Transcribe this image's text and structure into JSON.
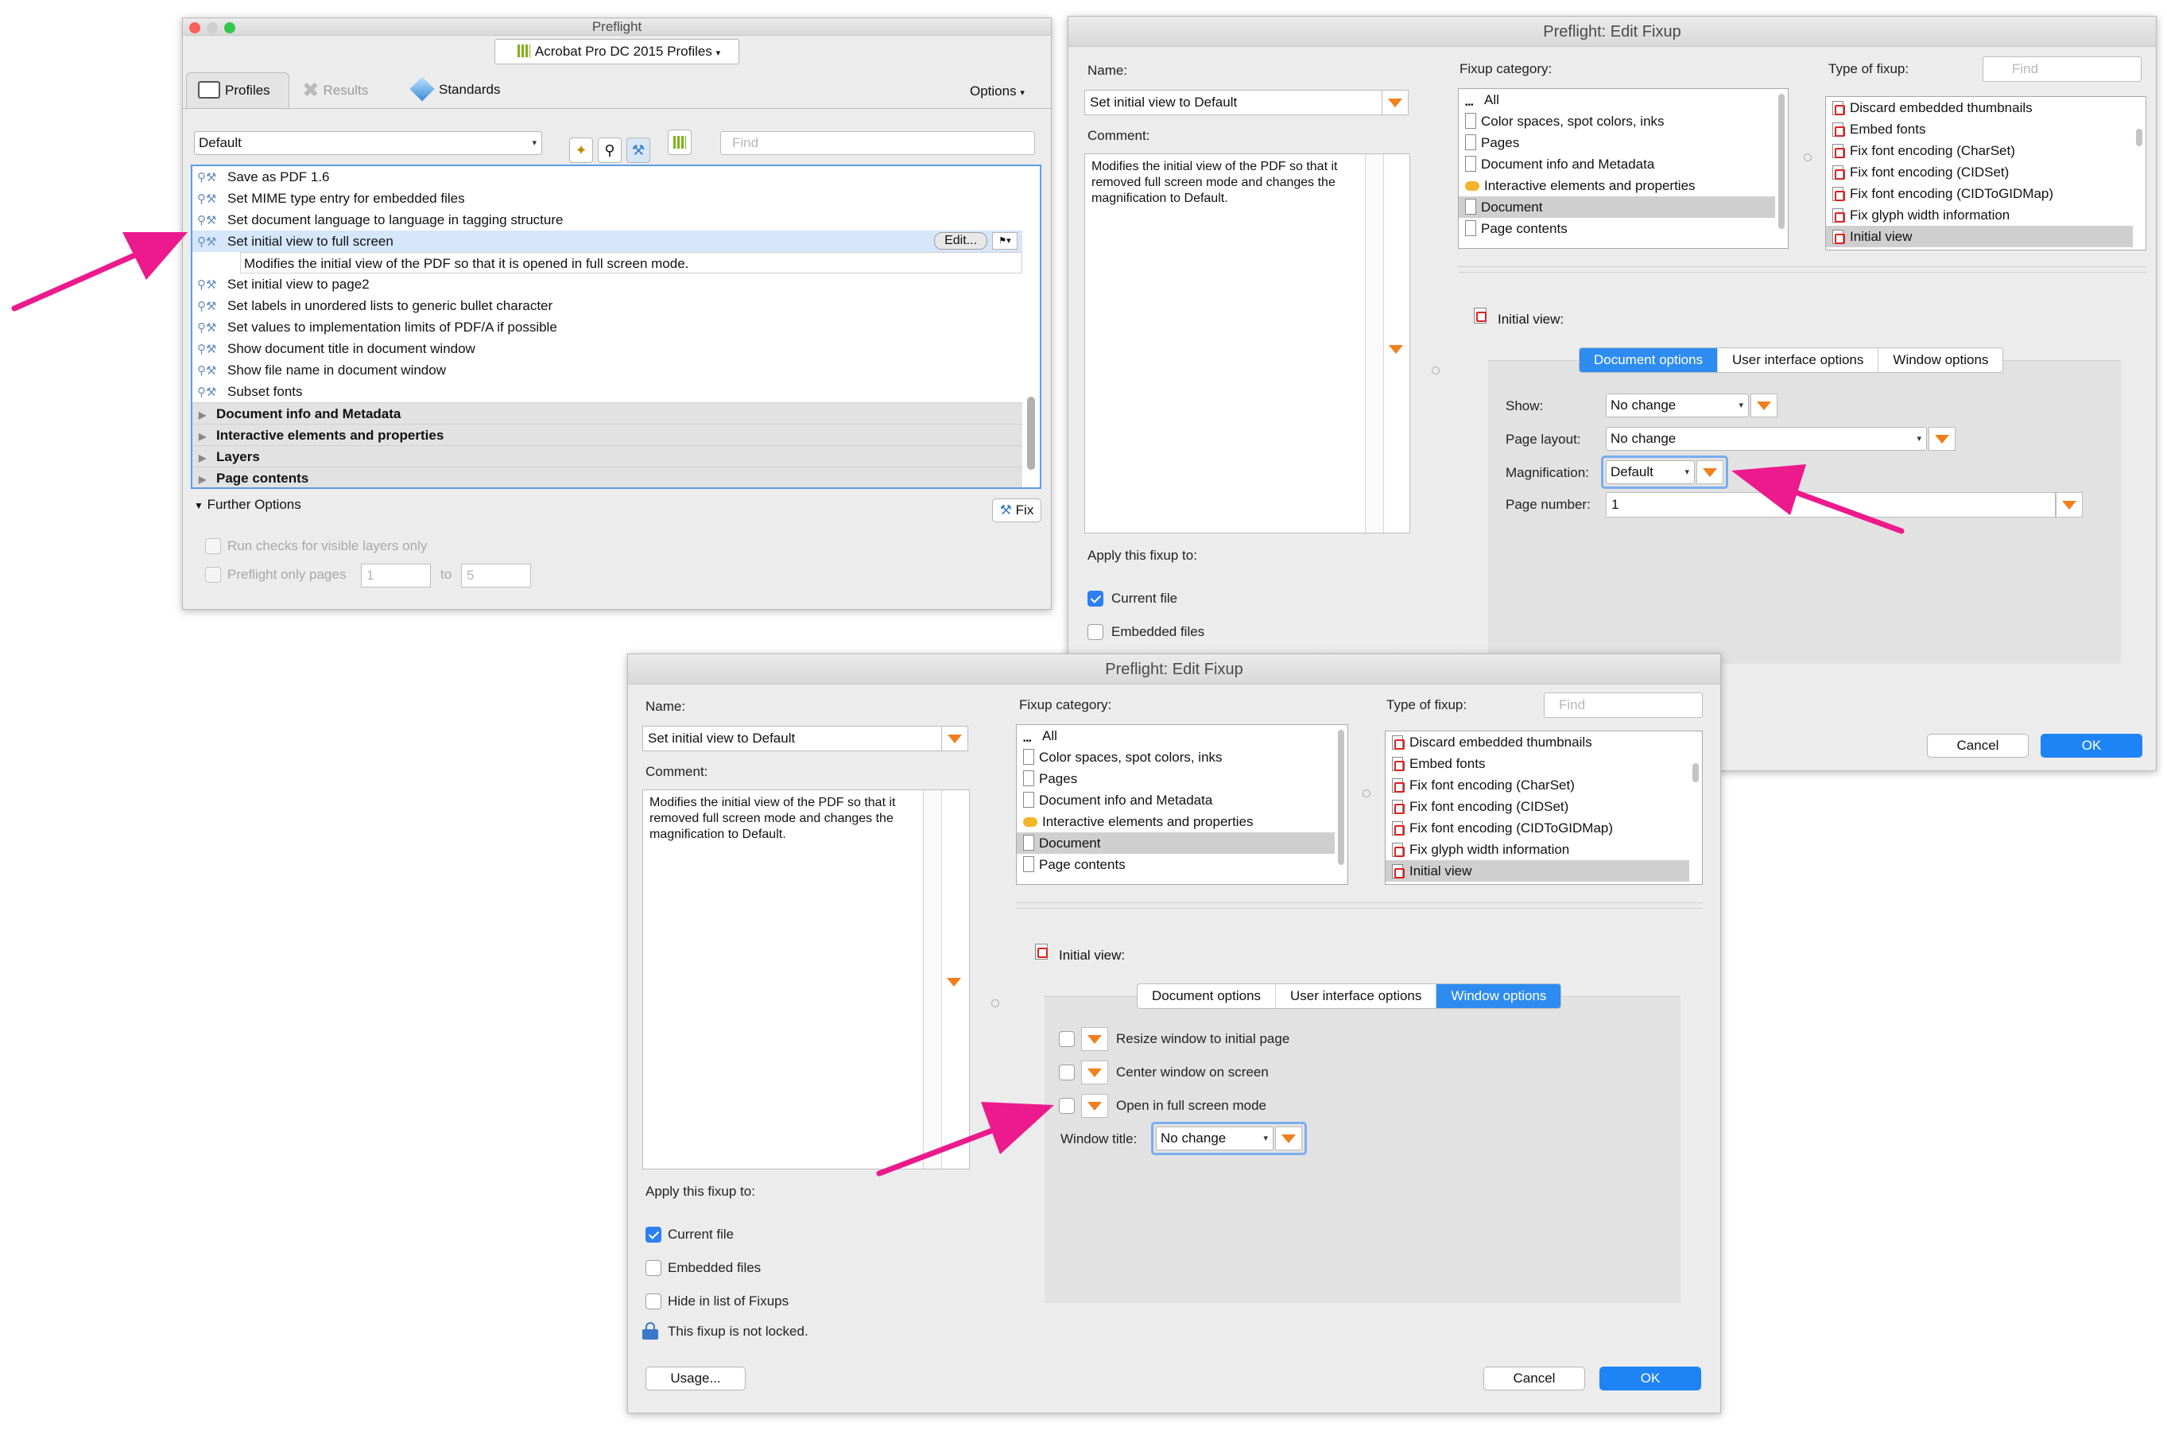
{
  "preflight": {
    "title": "Preflight",
    "profile_select": "Acrobat Pro DC 2015 Profiles",
    "tabs": [
      "Profiles",
      "Results",
      "Standards"
    ],
    "options_label": "Options",
    "library_select": "Default",
    "find_placeholder": "Find",
    "items": [
      {
        "label": "Save as PDF 1.6"
      },
      {
        "label": "Set MIME type entry for embedded files"
      },
      {
        "label": "Set document language to language in tagging structure"
      },
      {
        "label": "Set initial view to full screen",
        "selected": true
      }
    ],
    "selected_desc": "Modifies the initial view of the PDF so that it is opened in full screen mode.",
    "edit_label": "Edit...",
    "items_after": [
      {
        "label": "Set initial view to page2"
      },
      {
        "label": "Set labels in unordered lists to generic bullet character"
      },
      {
        "label": "Set values to implementation limits of PDF/A if possible"
      },
      {
        "label": "Show document title in document window"
      },
      {
        "label": "Show file name in document window"
      },
      {
        "label": "Subset fonts"
      }
    ],
    "groups": [
      "Document info and Metadata",
      "Interactive elements and properties",
      "Layers",
      "Page contents"
    ],
    "further_options": "Further Options",
    "fix_label": "Fix",
    "run_checks": "Run checks for visible layers only",
    "preflight_only": "Preflight only pages",
    "page_from": "1",
    "page_to_label": "to",
    "page_to": "5"
  },
  "edit1": {
    "title": "Preflight: Edit Fixup",
    "name_label": "Name:",
    "name_value": "Set initial view to Default",
    "comment_label": "Comment:",
    "comment_value": "Modifies the initial view of the PDF so that it removed full screen mode and changes the magnification to Default.",
    "category_label": "Fixup category:",
    "categories": [
      "All",
      "Color spaces, spot colors, inks",
      "Pages",
      "Document info and Metadata",
      "Interactive elements and properties",
      "Document",
      "Page contents"
    ],
    "type_label": "Type of fixup:",
    "type_find_placeholder": "Find",
    "types": [
      "Discard embedded thumbnails",
      "Embed fonts",
      "Fix font encoding (CharSet)",
      "Fix font encoding (CIDSet)",
      "Fix font encoding (CIDToGIDMap)",
      "Fix glyph width information",
      "Initial view"
    ],
    "initial_view_label": "Initial view:",
    "seg": [
      "Document options",
      "User interface options",
      "Window options"
    ],
    "show_label": "Show:",
    "show_value": "No change",
    "layout_label": "Page layout:",
    "layout_value": "No change",
    "mag_label": "Magnification:",
    "mag_value": "Default",
    "pagenum_label": "Page number:",
    "pagenum_value": "1",
    "apply_label": "Apply this fixup to:",
    "current_file": "Current file",
    "embedded_files": "Embedded files",
    "cancel": "Cancel",
    "ok": "OK"
  },
  "edit2": {
    "title": "Preflight: Edit Fixup",
    "name_label": "Name:",
    "name_value": "Set initial view to Default",
    "comment_label": "Comment:",
    "comment_value": "Modifies the initial view of the PDF so that it removed full screen mode and changes the magnification to Default.",
    "category_label": "Fixup category:",
    "categories": [
      "All",
      "Color spaces, spot colors, inks",
      "Pages",
      "Document info and Metadata",
      "Interactive elements and properties",
      "Document",
      "Page contents"
    ],
    "type_label": "Type of fixup:",
    "type_find_placeholder": "Find",
    "types": [
      "Discard embedded thumbnails",
      "Embed fonts",
      "Fix font encoding (CharSet)",
      "Fix font encoding (CIDSet)",
      "Fix font encoding (CIDToGIDMap)",
      "Fix glyph width information",
      "Initial view"
    ],
    "initial_view_label": "Initial view:",
    "seg": [
      "Document options",
      "User interface options",
      "Window options"
    ],
    "resize": "Resize window to initial page",
    "center": "Center window on screen",
    "fullscreen": "Open in full screen mode",
    "wintitle_label": "Window title:",
    "wintitle_value": "No change",
    "apply_label": "Apply this fixup to:",
    "current_file": "Current file",
    "embedded_files": "Embedded files",
    "hide_label": "Hide in list of Fixups",
    "lock_label": "This fixup is not locked.",
    "usage": "Usage...",
    "cancel": "Cancel",
    "ok": "OK"
  },
  "colors": {
    "accent": "#2e8cf0",
    "arrow": "#ec1a8c",
    "dropdown": "#f07f1c"
  }
}
